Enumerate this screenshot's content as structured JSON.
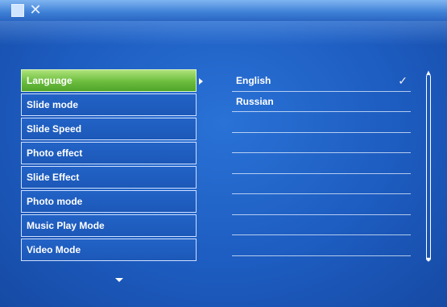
{
  "topbar": {
    "icons": [
      "photo-icon",
      "tools-icon"
    ]
  },
  "menu": {
    "items": [
      {
        "label": "Language",
        "selected": true
      },
      {
        "label": "Slide mode",
        "selected": false
      },
      {
        "label": "Slide Speed",
        "selected": false
      },
      {
        "label": "Photo effect",
        "selected": false
      },
      {
        "label": "Slide Effect",
        "selected": false
      },
      {
        "label": "Photo mode",
        "selected": false
      },
      {
        "label": "Music Play Mode",
        "selected": false
      },
      {
        "label": "Video Mode",
        "selected": false
      }
    ]
  },
  "options": {
    "items": [
      {
        "label": "English",
        "checked": true
      },
      {
        "label": "Russian",
        "checked": false
      },
      {
        "label": "",
        "checked": false
      },
      {
        "label": "",
        "checked": false
      },
      {
        "label": "",
        "checked": false
      },
      {
        "label": "",
        "checked": false
      },
      {
        "label": "",
        "checked": false
      },
      {
        "label": "",
        "checked": false
      },
      {
        "label": "",
        "checked": false
      }
    ],
    "check_glyph": "✓"
  },
  "colors": {
    "background": "#1f5fc0",
    "selected": "#7cc84a",
    "text": "#ffffff"
  }
}
